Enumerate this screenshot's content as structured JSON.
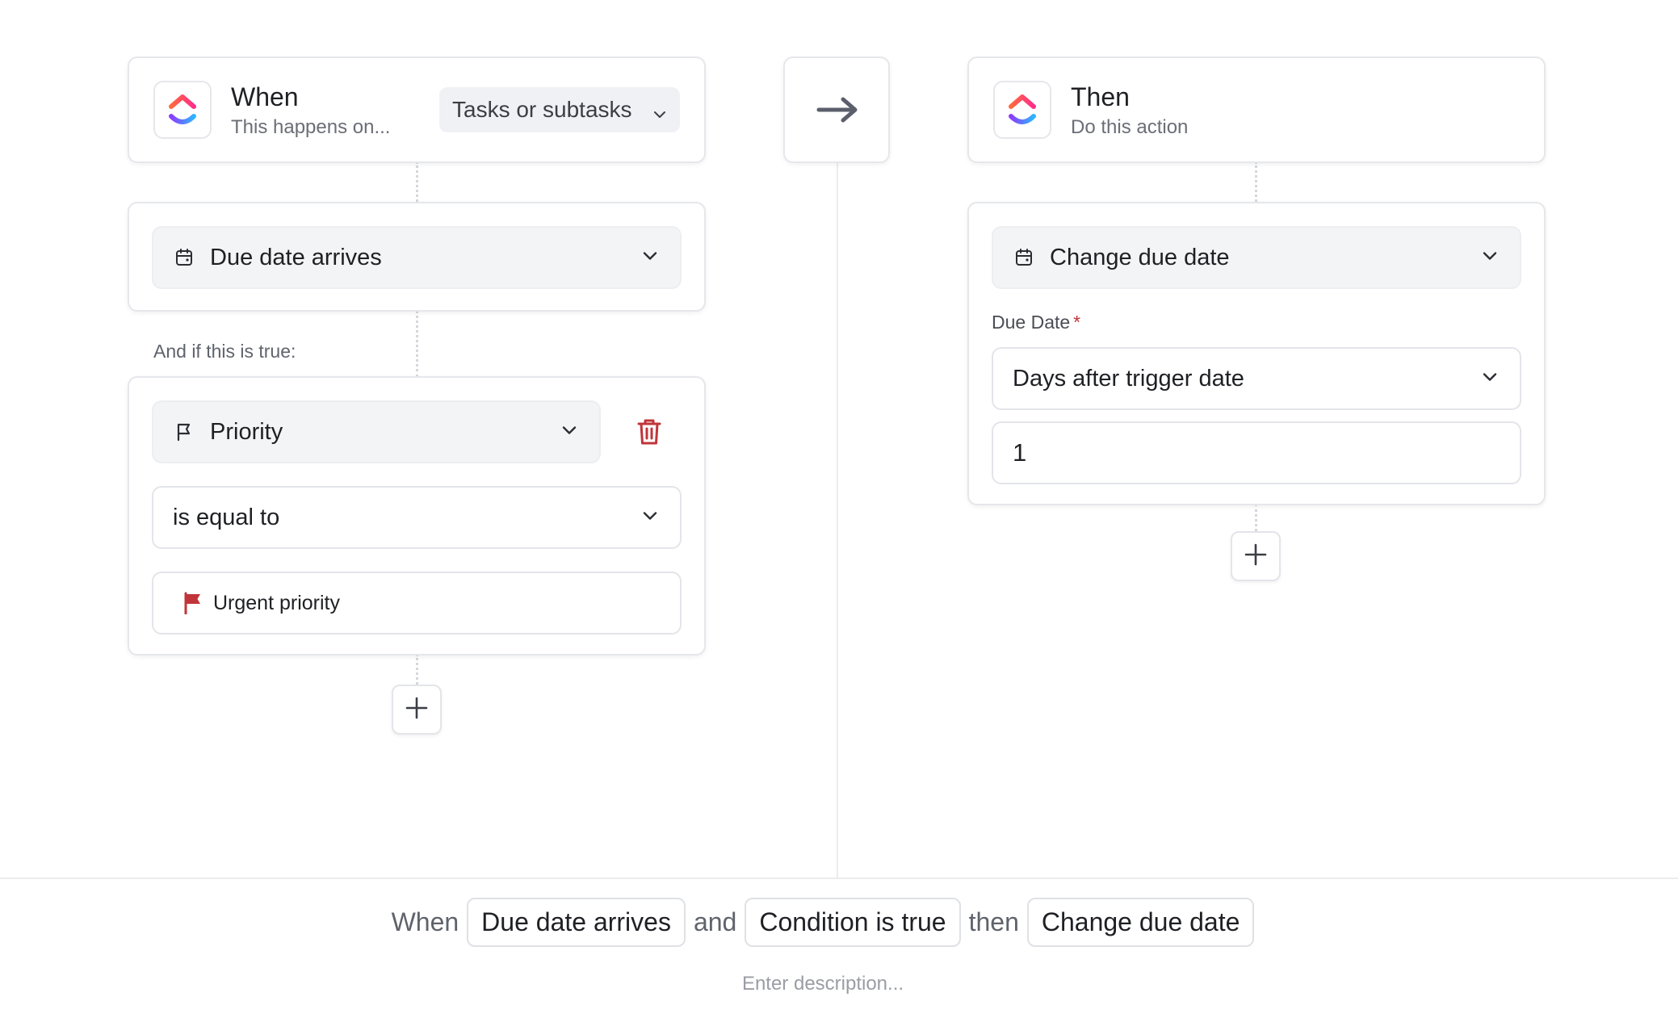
{
  "trigger": {
    "title": "When",
    "subtitle": "This happens on...",
    "scope_select": "Tasks or subtasks",
    "event_select": "Due date arrives"
  },
  "condition": {
    "label": "And if this is true:",
    "field_select": "Priority",
    "operator_select": "is equal to",
    "value": "Urgent priority"
  },
  "action": {
    "title": "Then",
    "subtitle": "Do this action",
    "action_select": "Change due date",
    "due_date_label": "Due Date",
    "required_marker": "*",
    "due_date_mode": "Days after trigger date",
    "days_value": "1"
  },
  "summary": {
    "when_word": "When",
    "trigger_chip": "Due date arrives",
    "and_word": "and",
    "condition_chip": "Condition is true",
    "then_word": "then",
    "action_chip": "Change due date",
    "description_placeholder": "Enter description..."
  },
  "colors": {
    "accent_red": "#c0353a",
    "flag_red": "#c0353a",
    "border": "#e6e7eb",
    "select_bg": "#f3f4f6"
  },
  "icons": {
    "logo": "clickup-logo-icon",
    "calendar": "calendar-icon",
    "flag": "flag-icon",
    "trash": "trash-icon",
    "chevron": "chevron-down-icon",
    "arrow": "arrow-right-icon",
    "plus": "plus-icon"
  }
}
